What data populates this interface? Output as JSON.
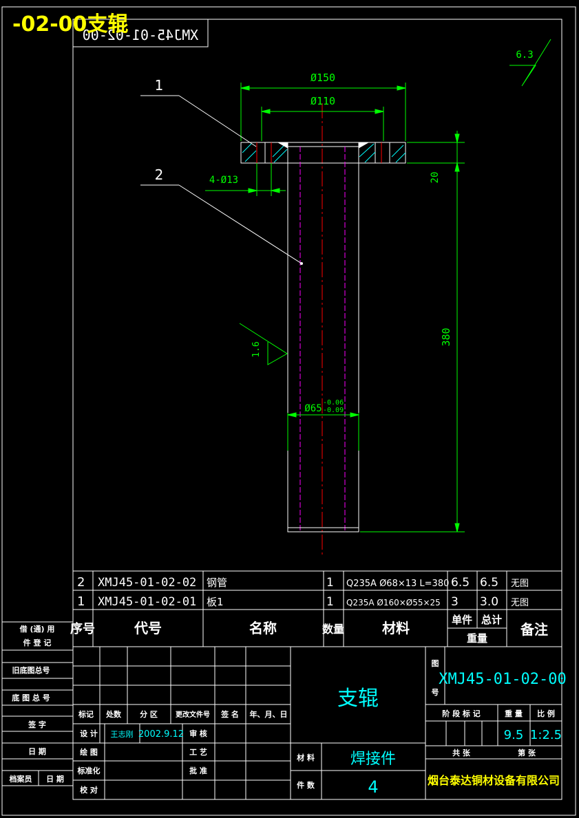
{
  "overlay_title": "-02-00支辊",
  "mirrored_code": "XMJ45-01-02-00",
  "surface_roughness": {
    "top_right": "6.3",
    "shaft": "1.6"
  },
  "callouts": {
    "part1": "1",
    "part2": "2"
  },
  "dimensions": {
    "flange_od": "Ø150",
    "bolt_circle": "Ø110",
    "holes": "4-Ø13",
    "flange_thickness": "20",
    "length": "380",
    "shaft_dia": "Ø65",
    "tol_upper": "-0.06",
    "tol_lower": "-0.09"
  },
  "bom": {
    "rows": [
      {
        "no": "2",
        "code": "XMJ45-01-02-02",
        "name": "钢管",
        "qty": "1",
        "material": "Q235A  Ø68×13  L=380",
        "unit_w": "6.5",
        "total_w": "6.5",
        "note": "无图"
      },
      {
        "no": "1",
        "code": "XMJ45-01-02-01",
        "name": "板1",
        "qty": "1",
        "material": "Q235A  Ø160×Ø55×25",
        "unit_w": "3",
        "total_w": "3.0",
        "note": "无图"
      }
    ],
    "headers": {
      "no": "序号",
      "code": "代号",
      "name": "名称",
      "qty": "数量",
      "material": "材料",
      "unit": "单件",
      "total": "总计",
      "weight": "重量",
      "note": "备注"
    }
  },
  "left_strip": {
    "borrow1": "借 (通) 用",
    "borrow2": "件  登  记",
    "old_base": "旧底图总号",
    "base": "底 图 总 号",
    "sign": "签     字",
    "date": "日     期",
    "archivist": "档案员",
    "archivist_date": "日  期"
  },
  "title_block": {
    "part_name": "支辊",
    "drawing_no_label1": "图",
    "drawing_no_label2": "号",
    "drawing_no": "XMJ45-01-02-00",
    "rev_headers": [
      "标记",
      "处数",
      "分 区",
      "更改文件号",
      "签 名",
      "年、月、日"
    ],
    "design": "设 计",
    "designer": "王志刚",
    "design_date": "2002.9.12",
    "review": "审 核",
    "draw": "绘 图",
    "process": "工 艺",
    "standard": "标准化",
    "approve": "批 准",
    "check": "校 对",
    "material_label": "材 料",
    "material": "焊接件",
    "quantity_label": "件 数",
    "quantity": "4",
    "stage_label": "阶 段 标 记",
    "weight_label": "重 量",
    "scale_label": "比 例",
    "weight": "9.5",
    "scale": "1:2.5",
    "total_sheets": "共       张",
    "sheet": "第       张",
    "company": "烟台泰达铜材设备有限公司"
  },
  "colors": {
    "line": "#ffffff",
    "dim": "#00ff00",
    "center": "#ff0000",
    "hidden": "#ff00ff",
    "cyan": "#00ffff",
    "title": "#ffff00"
  }
}
